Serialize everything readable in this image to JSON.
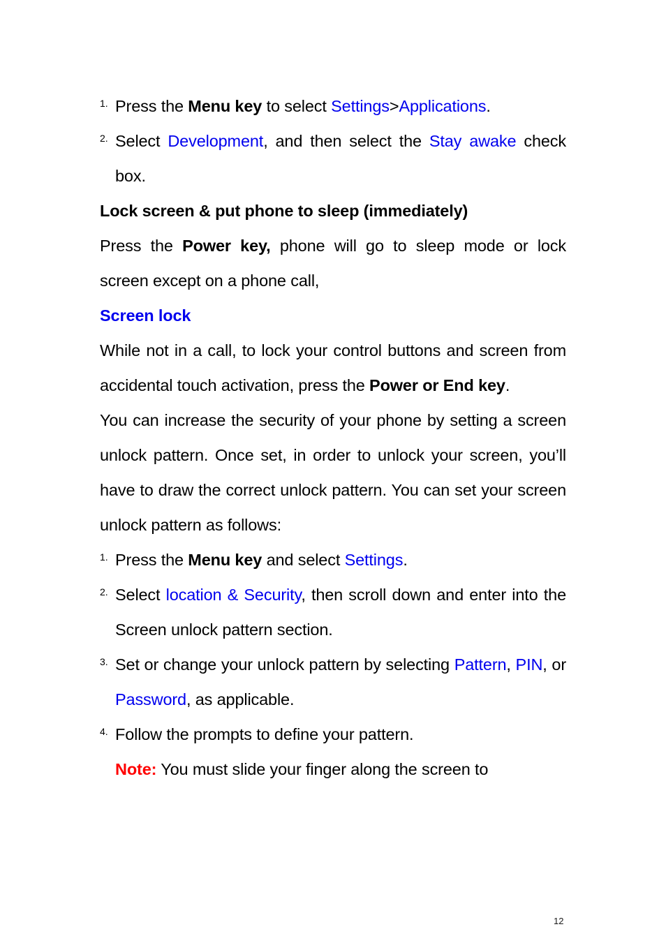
{
  "document": {
    "page_number": "12",
    "colors": {
      "link_blue": "#0000ee",
      "note_red": "#ff0000",
      "body_black": "#000000"
    }
  },
  "list_top": {
    "items": [
      {
        "marker": "1.",
        "segments": [
          {
            "text": "Press the ",
            "style": "normal"
          },
          {
            "text": "Menu key",
            "style": "bold"
          },
          {
            "text": " to select ",
            "style": "normal"
          },
          {
            "text": "Settings",
            "style": "blue"
          },
          {
            "text": ">",
            "style": "normal"
          },
          {
            "text": "Applications",
            "style": "blue"
          },
          {
            "text": ".",
            "style": "normal"
          }
        ]
      },
      {
        "marker": "2.",
        "segments": [
          {
            "text": "Select ",
            "style": "normal"
          },
          {
            "text": "Development",
            "style": "blue"
          },
          {
            "text": ", and then select the ",
            "style": "normal"
          },
          {
            "text": "Stay awake",
            "style": "blue"
          },
          {
            "text": " check box.",
            "style": "normal"
          }
        ]
      }
    ]
  },
  "section_lock_screen": {
    "heading": "Lock screen & put phone to sleep (immediately)",
    "paragraph": {
      "segments": [
        {
          "text": "Press the ",
          "style": "normal"
        },
        {
          "text": "Power key,",
          "style": "bold"
        },
        {
          "text": " phone will go to sleep mode or lock screen except on a phone call,",
          "style": "normal"
        }
      ]
    }
  },
  "section_screen_lock": {
    "heading": "Screen lock",
    "paragraph_1": {
      "segments": [
        {
          "text": "While not in a call, to lock your control buttons and screen from accidental touch activation, press the ",
          "style": "normal"
        },
        {
          "text": "Power or End key",
          "style": "bold"
        },
        {
          "text": ".",
          "style": "normal"
        }
      ]
    },
    "paragraph_2": {
      "text": "You can increase the security of your phone by setting a screen unlock pattern. Once set, in order to unlock your screen, you’ll have to draw the correct unlock pattern. You can set your screen unlock pattern as follows:"
    }
  },
  "list_bottom": {
    "items": [
      {
        "marker": "1.",
        "segments": [
          {
            "text": "Press the ",
            "style": "normal"
          },
          {
            "text": "Menu key",
            "style": "bold"
          },
          {
            "text": " and select ",
            "style": "normal"
          },
          {
            "text": "Settings",
            "style": "blue"
          },
          {
            "text": ".",
            "style": "normal"
          }
        ]
      },
      {
        "marker": "2.",
        "segments": [
          {
            "text": "Select ",
            "style": "normal"
          },
          {
            "text": "location & Security",
            "style": "blue"
          },
          {
            "text": ", then scroll down and enter into the Screen unlock pattern section.",
            "style": "normal"
          }
        ]
      },
      {
        "marker": "3.",
        "segments": [
          {
            "text": "Set or change your unlock pattern by selecting ",
            "style": "normal"
          },
          {
            "text": "Pattern",
            "style": "blue"
          },
          {
            "text": ", ",
            "style": "normal"
          },
          {
            "text": "PIN",
            "style": "blue"
          },
          {
            "text": ", or ",
            "style": "normal"
          },
          {
            "text": "Password",
            "style": "blue"
          },
          {
            "text": ", as applicable.",
            "style": "normal"
          }
        ]
      },
      {
        "marker": "4.",
        "segments": [
          {
            "text": "Follow the prompts to define your pattern.",
            "style": "normal"
          }
        ]
      }
    ]
  },
  "note": {
    "label": "Note:",
    "text": " You must slide your finger along the screen to"
  }
}
